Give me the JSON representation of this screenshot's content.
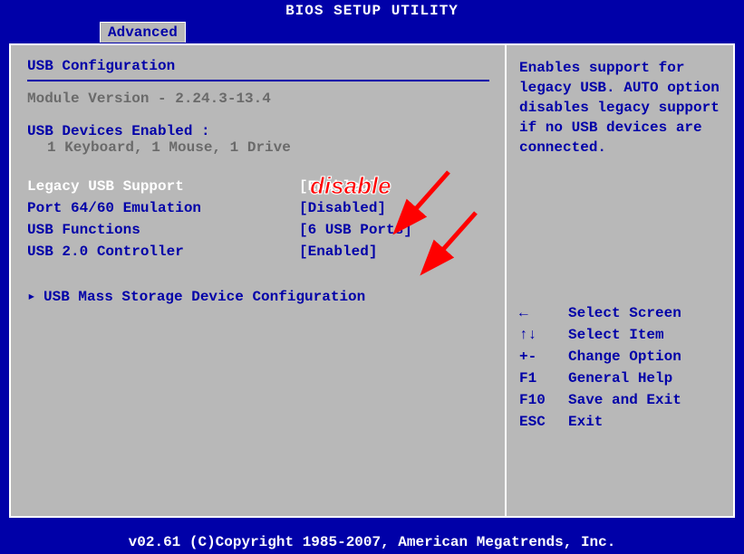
{
  "title": "BIOS SETUP UTILITY",
  "tab": "Advanced",
  "section_title": "USB Configuration",
  "module_version": "Module Version - 2.24.3-13.4",
  "devices_label": "USB Devices Enabled :",
  "devices_list": "1 Keyboard, 1 Mouse, 1 Drive",
  "settings": [
    {
      "label": "Legacy USB Support",
      "value": "[Enabled]",
      "selected": true
    },
    {
      "label": "Port 64/60 Emulation",
      "value": "[Disabled]",
      "selected": false
    },
    {
      "label": "USB Functions",
      "value": "[6 USB Ports]",
      "selected": false
    },
    {
      "label": "USB 2.0 Controller",
      "value": "[Enabled]",
      "selected": false
    }
  ],
  "submenu": "USB Mass Storage Device Configuration",
  "help_text": "Enables support for legacy USB. AUTO option disables legacy support if no USB devices are connected.",
  "keys": [
    {
      "key": "←",
      "label": "Select Screen"
    },
    {
      "key": "↑↓",
      "label": "Select Item"
    },
    {
      "key": "+-",
      "label": "Change Option"
    },
    {
      "key": "F1",
      "label": "General Help"
    },
    {
      "key": "F10",
      "label": "Save and Exit"
    },
    {
      "key": "ESC",
      "label": "Exit"
    }
  ],
  "footer": "v02.61 (C)Copyright 1985-2007, American Megatrends, Inc.",
  "annotation": "disable"
}
